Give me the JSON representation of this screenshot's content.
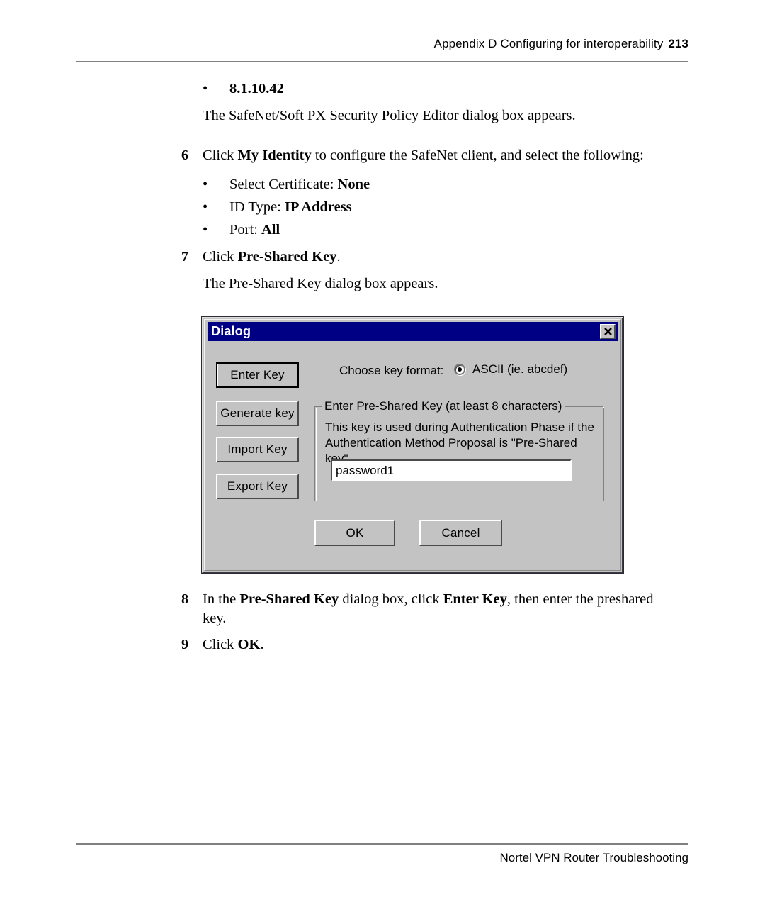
{
  "header": {
    "text": "Appendix D  Configuring for interoperability",
    "page_number": "213"
  },
  "footer": {
    "text": "Nortel VPN Router Troubleshooting"
  },
  "content": {
    "ip_bullet": "8.1.10.42",
    "editor_sentence": "The SafeNet/Soft PX Security Policy Editor dialog box appears.",
    "step6_number": "6",
    "step6_pre": "Click ",
    "step6_bold": "My Identity",
    "step6_post": " to configure the SafeNet client, and select the following:",
    "sub_bullets": [
      {
        "label": "Select Certificate: ",
        "value": "None"
      },
      {
        "label": "ID Type: ",
        "value": "IP Address"
      },
      {
        "label": "Port: ",
        "value": "All"
      }
    ],
    "step7_number": "7",
    "step7_pre": "Click ",
    "step7_bold": "Pre-Shared Key",
    "step7_post": ".",
    "psk_sentence": "The Pre-Shared Key dialog box appears.",
    "step8_number": "8",
    "step8_a": "In the ",
    "step8_b1": "Pre-Shared Key",
    "step8_c": " dialog box, click ",
    "step8_b2": "Enter Key",
    "step8_d": ", then enter the preshared",
    "step8_line2": "key.",
    "step9_number": "9",
    "step9_pre": "Click ",
    "step9_bold": "OK",
    "step9_post": "."
  },
  "dialog": {
    "title": "Dialog",
    "close_icon": "close-icon",
    "buttons": {
      "enter_key": "Enter Key",
      "generate_key": "Generate key",
      "import_key": "Import Key",
      "export_key": "Export Key",
      "ok": "OK",
      "cancel": "Cancel"
    },
    "format_label": "Choose key format:",
    "format_option": "ASCII (ie. abcdef)",
    "group_legend_a": "Enter ",
    "group_legend_accel": "P",
    "group_legend_b": "re-Shared Key (at least 8 characters)",
    "group_description": "This key is used during Authentication Phase if the\nAuthentication Method Proposal is \"Pre-Shared key\".",
    "key_value": "password1"
  },
  "colors": {
    "titlebar": "#000084",
    "dialog_face": "#c3c3c3",
    "rule": "#808080"
  }
}
